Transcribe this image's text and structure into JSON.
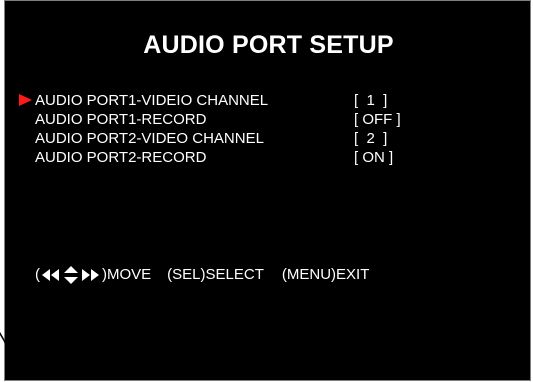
{
  "title": "AUDIO PORT SETUP",
  "menu": {
    "items": [
      {
        "label": "AUDIO PORT1-VIDEIO CHANNEL",
        "value": "[  1  ]",
        "selected": true
      },
      {
        "label": "AUDIO PORT1-RECORD",
        "value": "[ OFF ]",
        "selected": false
      },
      {
        "label": "AUDIO PORT2-VIDEO CHANNEL",
        "value": "[  2  ]",
        "selected": false
      },
      {
        "label": "AUDIO PORT2-RECORD",
        "value": "[ ON ]",
        "selected": false
      }
    ]
  },
  "hints": {
    "open_paren": "(",
    "move": ")MOVE",
    "select": "(SEL)SELECT",
    "exit": "(MENU)EXIT",
    "icons": [
      "double-left-arrow-icon",
      "up-down-arrow-icon",
      "double-right-arrow-icon"
    ]
  },
  "colors": {
    "background": "#000000",
    "text": "#ffffff",
    "cursor": "#ff1a1a"
  }
}
